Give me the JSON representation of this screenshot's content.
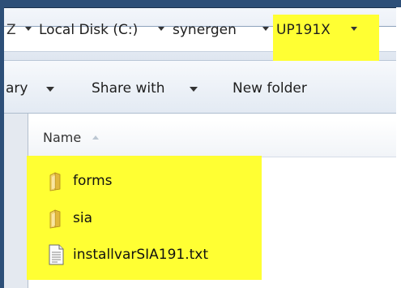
{
  "address": {
    "crumbs": [
      "Local Disk (C:)",
      "synergen",
      "UP191X"
    ],
    "cut_prefix": "Z"
  },
  "toolbar": {
    "organize_cut": "ary",
    "share_label": "Share with",
    "new_folder_label": "New folder"
  },
  "columns": {
    "name": "Name"
  },
  "files": [
    {
      "name": "forms",
      "type": "folder"
    },
    {
      "name": "sia",
      "type": "folder"
    },
    {
      "name": "installvarSIA191.txt",
      "type": "text-file"
    }
  ],
  "colors": {
    "highlight": "#ffff33",
    "window_frame": "#2d4f78",
    "folder": "#e2b93b"
  }
}
